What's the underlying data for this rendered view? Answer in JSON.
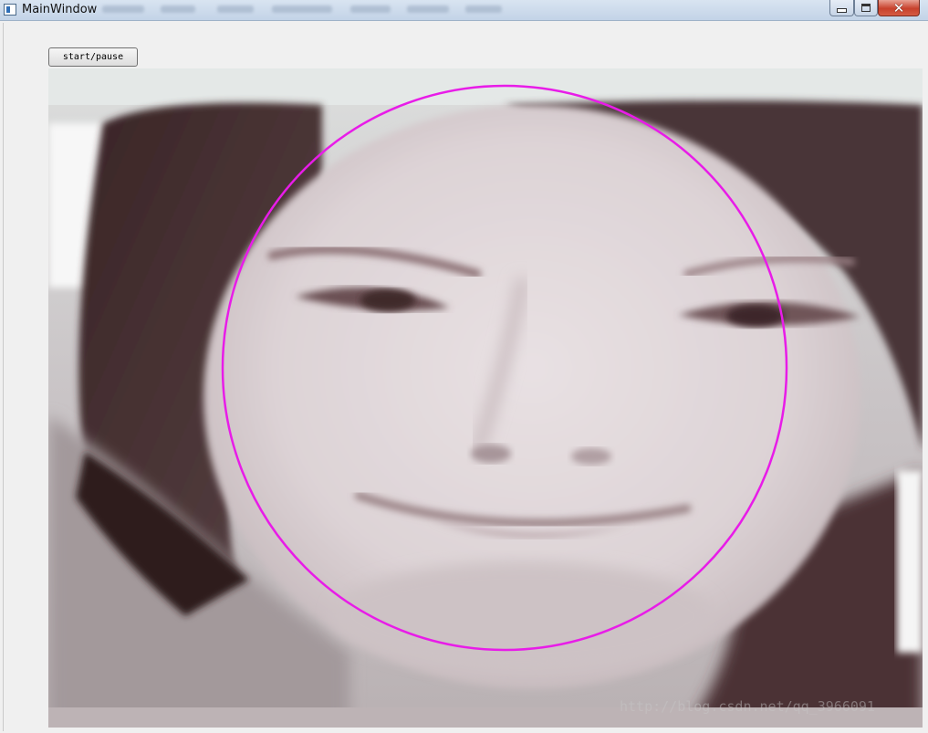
{
  "window": {
    "title": "MainWindow",
    "controls": {
      "minimize": "minimize",
      "maximize": "maximize",
      "close": "close"
    }
  },
  "toolbar": {
    "start_pause_label": "start/pause"
  },
  "video": {
    "content": "camera frame of a smiling face",
    "detection_overlay": {
      "shape": "circle",
      "color": "#e81ce8"
    },
    "watermark": "http://blog.csdn.net/qq_3966091"
  },
  "colors": {
    "window_bg": "#f0f0f0",
    "close_button": "#c7412c",
    "detection_circle": "#e81ce8"
  }
}
